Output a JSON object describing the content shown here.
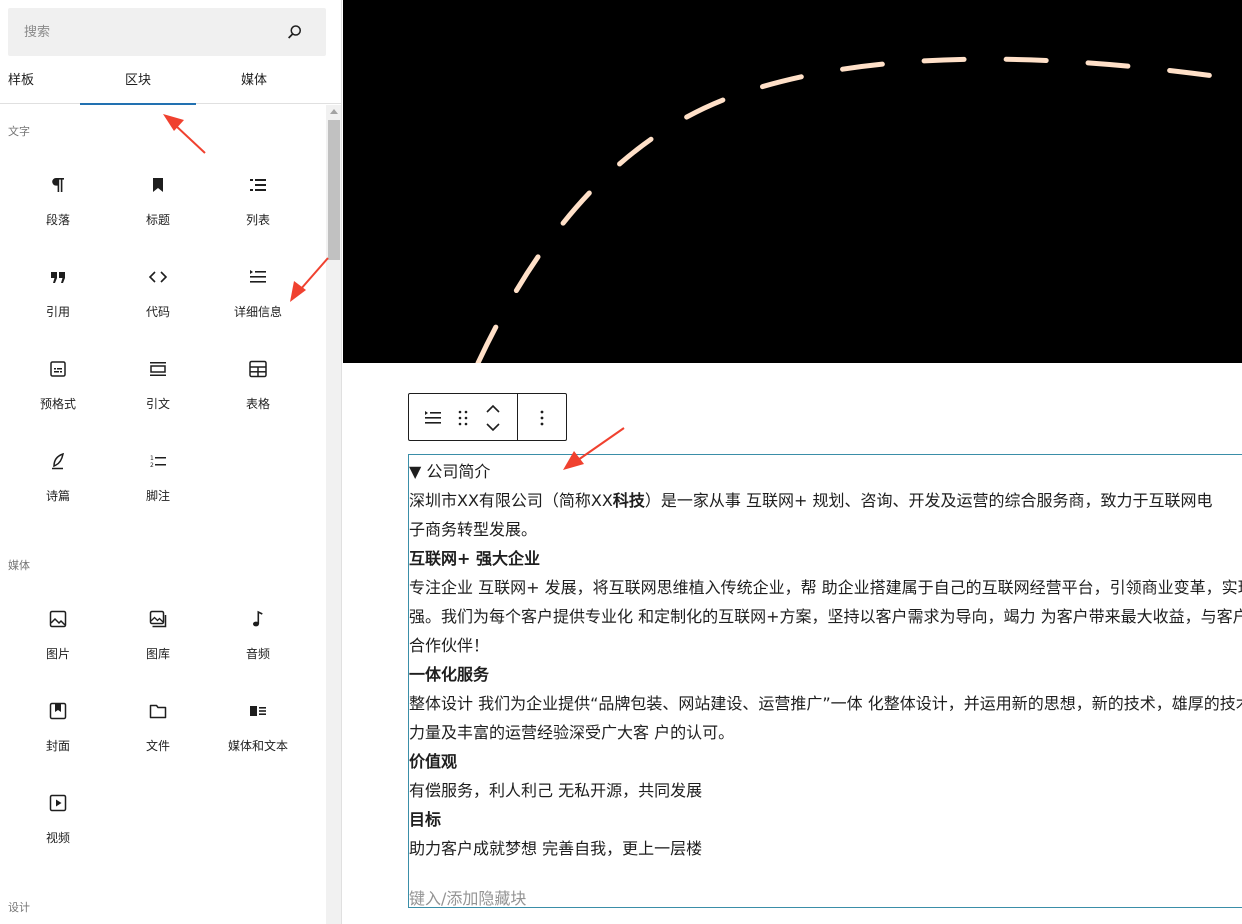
{
  "sidebar": {
    "search": {
      "placeholder": "搜索"
    },
    "tabs": [
      {
        "label": "样板"
      },
      {
        "label": "区块",
        "active": true
      },
      {
        "label": "媒体"
      }
    ],
    "categories": [
      {
        "title": "文字",
        "blocks": [
          {
            "label": "段落",
            "icon": "paragraph-icon"
          },
          {
            "label": "标题",
            "icon": "heading-bookmark-icon"
          },
          {
            "label": "列表",
            "icon": "list-icon"
          },
          {
            "label": "引用",
            "icon": "quote-icon"
          },
          {
            "label": "代码",
            "icon": "code-icon"
          },
          {
            "label": "详细信息",
            "icon": "details-icon"
          },
          {
            "label": "预格式",
            "icon": "preformatted-icon"
          },
          {
            "label": "引文",
            "icon": "pullquote-icon"
          },
          {
            "label": "表格",
            "icon": "table-icon"
          },
          {
            "label": "诗篇",
            "icon": "verse-feather-icon"
          },
          {
            "label": "脚注",
            "icon": "footnotes-icon"
          }
        ]
      },
      {
        "title": "媒体",
        "blocks": [
          {
            "label": "图片",
            "icon": "image-icon"
          },
          {
            "label": "图库",
            "icon": "gallery-icon"
          },
          {
            "label": "音频",
            "icon": "audio-note-icon"
          },
          {
            "label": "封面",
            "icon": "cover-icon"
          },
          {
            "label": "文件",
            "icon": "file-folder-icon"
          },
          {
            "label": "媒体和文本",
            "icon": "media-text-icon"
          },
          {
            "label": "视频",
            "icon": "video-icon"
          }
        ]
      },
      {
        "title": "设计",
        "blocks": []
      }
    ]
  },
  "editor": {
    "cover": {
      "background": "#000000",
      "dash_color": "#ffe0c8"
    },
    "toolbar": [
      "details-icon",
      "drag-handle-icon",
      "move-up-down-icon",
      "more-options-icon"
    ],
    "details": {
      "summary": "▼ 公司简介",
      "lines": [
        {
          "text": "深圳市XX有限公司（简称XX",
          "bold": "科技",
          "rest": "）是一家从事 互联网+ 规划、咨询、开发及运营的综合服务商，致力于互联网电"
        },
        {
          "text": "子商务转型发展。"
        },
        {
          "text": "互联网+ 强大企业",
          "heading": true
        },
        {
          "text": "专注企业 互联网+ 发展，将互联网思维植入传统企业，帮 助企业搭建属于自己的互联网经营平台，引领商业变革，实现企业做大做"
        },
        {
          "text": "强。我们为每个客户提供专业化 和定制化的互联网+方案，坚持以客户需求为导向，竭力 为客户带来最大收益，与客户共同成长的"
        },
        {
          "text": "合作伙伴！"
        },
        {
          "text": "一体化服务",
          "heading": true
        },
        {
          "text": "整体设计 我们为企业提供“品牌包装、网站建设、运营推广”一体 化整体设计，并运用新的思想，新的技术，雄厚的技术"
        },
        {
          "text": "力量及丰富的运营经验深受广大客 户的认可。"
        },
        {
          "text": "价值观",
          "heading": true
        },
        {
          "text": "有偿服务，利人利己 无私开源，共同发展"
        },
        {
          "text": "目标",
          "heading": true
        },
        {
          "text": "助力客户成就梦想 完善自我，更上一层楼"
        }
      ],
      "placeholder": "键入/添加隐藏块"
    }
  },
  "colors": {
    "accent": "#3858e9",
    "details_border": "#3a8ea8",
    "annotation_arrow": "#f0412f"
  }
}
